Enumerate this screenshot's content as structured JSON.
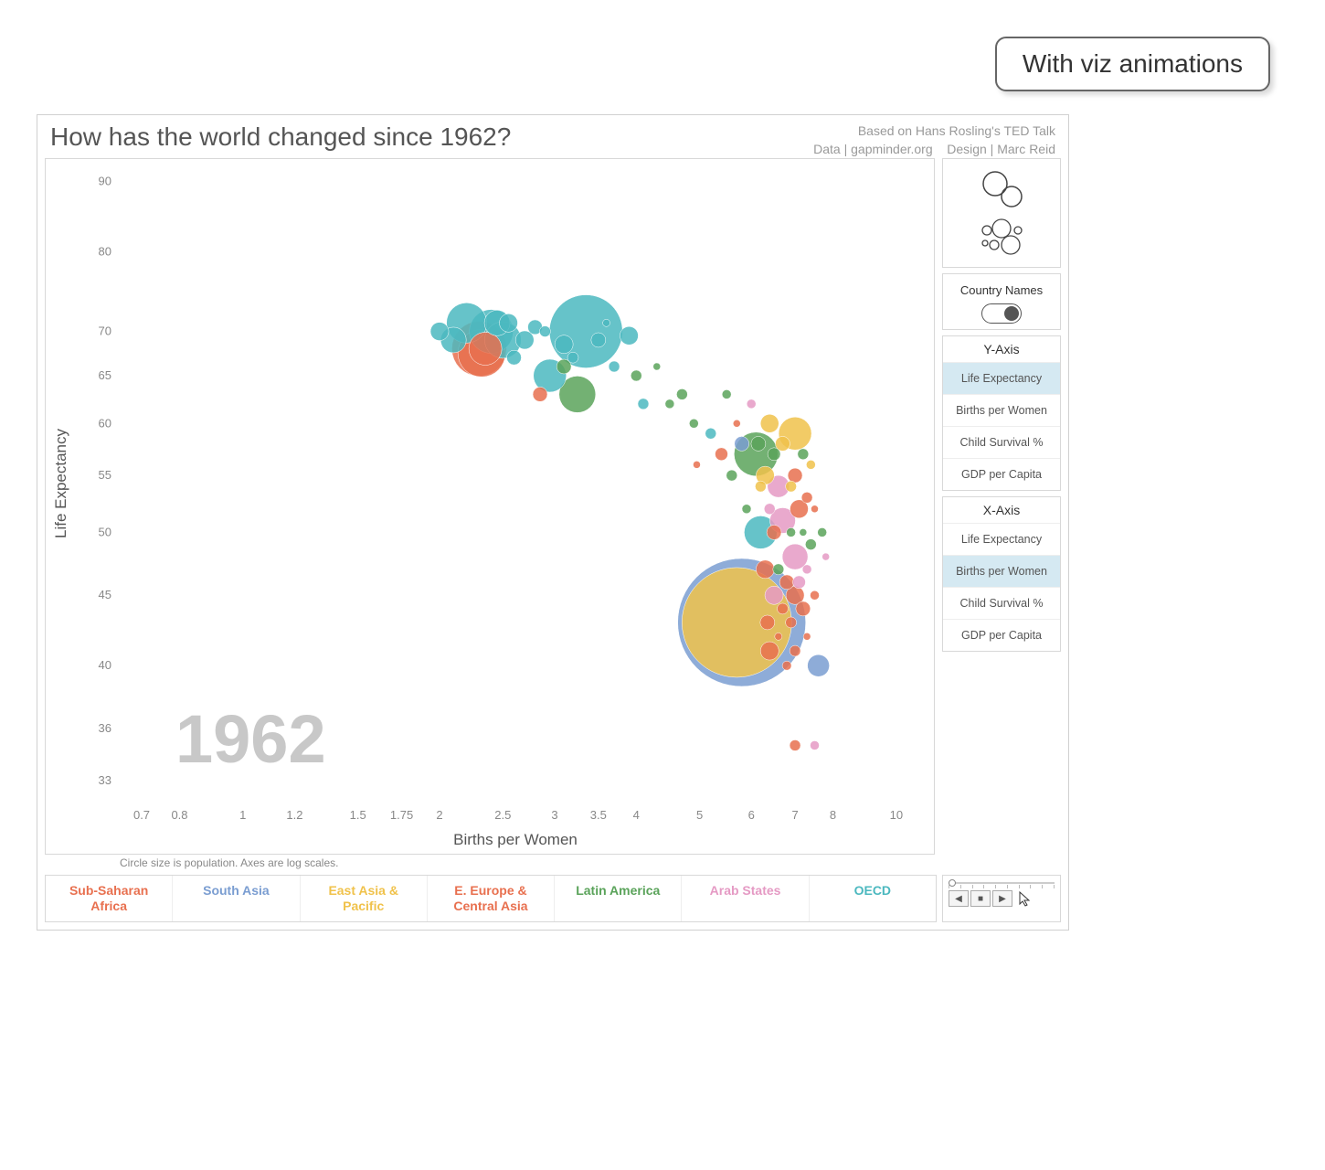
{
  "callout": "With viz animations",
  "header": {
    "title": "How has the world changed since 1962?",
    "credit1": "Based on Hans Rosling's TED Talk",
    "credit2_left": "Data | gapminder.org",
    "credit2_right": "Design | Marc Reid"
  },
  "sidebar": {
    "country_names_label": "Country Names",
    "y_axis_header": "Y-Axis",
    "y_options": [
      "Life Expectancy",
      "Births per Women",
      "Child Survival %",
      "GDP per Capita"
    ],
    "y_selected": 0,
    "x_axis_header": "X-Axis",
    "x_options": [
      "Life Expectancy",
      "Births per Women",
      "Child Survival %",
      "GDP per Capita"
    ],
    "x_selected": 1
  },
  "legend": [
    {
      "label": "Sub-Saharan Africa",
      "color": "#e8704f"
    },
    {
      "label": "South Asia",
      "color": "#7a9dd1"
    },
    {
      "label": "East Asia & Pacific",
      "color": "#f0c24b"
    },
    {
      "label": "E. Europe & Central Asia",
      "color": "#e8704f"
    },
    {
      "label": "Latin America",
      "color": "#5aa35a"
    },
    {
      "label": "Arab States",
      "color": "#e59ac4"
    },
    {
      "label": "OECD",
      "color": "#4bb8bf"
    }
  ],
  "note": "Circle size is population.  Axes are log scales.",
  "chart_data": {
    "type": "scatter",
    "title": "How has the world changed since 1962?",
    "xlabel": "Births per Women",
    "ylabel": "Life Expectancy",
    "year_label": "1962",
    "x_ticks": [
      0.7,
      0.8,
      1,
      1.2,
      1.5,
      1.75,
      2,
      2.5,
      3,
      3.5,
      4,
      5,
      6,
      7,
      8,
      10
    ],
    "y_ticks": [
      33,
      36,
      40,
      45,
      50,
      55,
      60,
      65,
      70,
      80,
      90
    ],
    "xlim": [
      0.65,
      10.5
    ],
    "ylim": [
      32,
      92
    ],
    "size_encodes": "population",
    "log_x": true,
    "log_y": true,
    "series_colors": {
      "Sub-Saharan Africa": "#e8704f",
      "South Asia": "#7a9dd1",
      "East Asia & Pacific": "#f0c24b",
      "E. Europe & Central Asia": "#e8704f",
      "Latin America": "#5aa35a",
      "Arab States": "#e59ac4",
      "OECD": "#4bb8bf"
    },
    "points": [
      {
        "x": 2.0,
        "y": 70,
        "r": 10,
        "region": "OECD"
      },
      {
        "x": 2.1,
        "y": 69,
        "r": 14,
        "region": "OECD"
      },
      {
        "x": 2.2,
        "y": 71,
        "r": 22,
        "region": "OECD"
      },
      {
        "x": 2.3,
        "y": 68,
        "r": 30,
        "region": "E. Europe & Central Asia"
      },
      {
        "x": 2.32,
        "y": 67.5,
        "r": 26,
        "region": "E. Europe & Central Asia"
      },
      {
        "x": 2.35,
        "y": 68,
        "r": 18,
        "region": "E. Europe & Central Asia"
      },
      {
        "x": 2.4,
        "y": 70,
        "r": 24,
        "region": "OECD"
      },
      {
        "x": 2.45,
        "y": 71,
        "r": 14,
        "region": "OECD"
      },
      {
        "x": 2.5,
        "y": 69,
        "r": 20,
        "region": "OECD"
      },
      {
        "x": 2.55,
        "y": 71,
        "r": 10,
        "region": "OECD"
      },
      {
        "x": 2.6,
        "y": 67,
        "r": 8,
        "region": "OECD"
      },
      {
        "x": 2.7,
        "y": 69,
        "r": 10,
        "region": "OECD"
      },
      {
        "x": 2.8,
        "y": 70.5,
        "r": 8,
        "region": "OECD"
      },
      {
        "x": 2.9,
        "y": 70,
        "r": 6,
        "region": "OECD"
      },
      {
        "x": 2.95,
        "y": 65,
        "r": 18,
        "region": "OECD"
      },
      {
        "x": 2.85,
        "y": 63,
        "r": 8,
        "region": "E. Europe & Central Asia"
      },
      {
        "x": 3.1,
        "y": 68.5,
        "r": 10,
        "region": "OECD"
      },
      {
        "x": 3.1,
        "y": 66,
        "r": 8,
        "region": "Latin America"
      },
      {
        "x": 3.2,
        "y": 67,
        "r": 6,
        "region": "OECD"
      },
      {
        "x": 3.25,
        "y": 63,
        "r": 20,
        "region": "Latin America"
      },
      {
        "x": 3.35,
        "y": 70,
        "r": 40,
        "region": "OECD"
      },
      {
        "x": 3.5,
        "y": 69,
        "r": 8,
        "region": "OECD"
      },
      {
        "x": 3.6,
        "y": 71,
        "r": 4,
        "region": "OECD"
      },
      {
        "x": 3.7,
        "y": 66,
        "r": 6,
        "region": "OECD"
      },
      {
        "x": 3.9,
        "y": 69.5,
        "r": 10,
        "region": "OECD"
      },
      {
        "x": 4.0,
        "y": 65,
        "r": 6,
        "region": "Latin America"
      },
      {
        "x": 4.1,
        "y": 62,
        "r": 6,
        "region": "OECD"
      },
      {
        "x": 4.3,
        "y": 66,
        "r": 4,
        "region": "Latin America"
      },
      {
        "x": 4.5,
        "y": 62,
        "r": 5,
        "region": "Latin America"
      },
      {
        "x": 4.7,
        "y": 63,
        "r": 6,
        "region": "Latin America"
      },
      {
        "x": 4.9,
        "y": 60,
        "r": 5,
        "region": "Latin America"
      },
      {
        "x": 4.95,
        "y": 56,
        "r": 4,
        "region": "E. Europe & Central Asia"
      },
      {
        "x": 5.2,
        "y": 59,
        "r": 6,
        "region": "OECD"
      },
      {
        "x": 5.4,
        "y": 57,
        "r": 7,
        "region": "E. Europe & Central Asia"
      },
      {
        "x": 5.5,
        "y": 63,
        "r": 5,
        "region": "Latin America"
      },
      {
        "x": 5.6,
        "y": 55,
        "r": 6,
        "region": "Latin America"
      },
      {
        "x": 5.7,
        "y": 60,
        "r": 4,
        "region": "E. Europe & Central Asia"
      },
      {
        "x": 5.8,
        "y": 58,
        "r": 8,
        "region": "South Asia"
      },
      {
        "x": 5.9,
        "y": 52,
        "r": 5,
        "region": "Latin America"
      },
      {
        "x": 5.8,
        "y": 43,
        "r": 70,
        "region": "South Asia"
      },
      {
        "x": 5.7,
        "y": 43,
        "r": 60,
        "region": "East Asia & Pacific"
      },
      {
        "x": 6.0,
        "y": 62,
        "r": 5,
        "region": "Arab States"
      },
      {
        "x": 6.1,
        "y": 57,
        "r": 24,
        "region": "Latin America"
      },
      {
        "x": 6.15,
        "y": 58,
        "r": 8,
        "region": "Latin America"
      },
      {
        "x": 6.2,
        "y": 54,
        "r": 6,
        "region": "East Asia & Pacific"
      },
      {
        "x": 6.2,
        "y": 50,
        "r": 18,
        "region": "OECD"
      },
      {
        "x": 6.3,
        "y": 55,
        "r": 10,
        "region": "East Asia & Pacific"
      },
      {
        "x": 6.3,
        "y": 47,
        "r": 10,
        "region": "Sub-Saharan Africa"
      },
      {
        "x": 6.35,
        "y": 43,
        "r": 8,
        "region": "Sub-Saharan Africa"
      },
      {
        "x": 6.4,
        "y": 60,
        "r": 10,
        "region": "East Asia & Pacific"
      },
      {
        "x": 6.4,
        "y": 52,
        "r": 6,
        "region": "Arab States"
      },
      {
        "x": 6.4,
        "y": 41,
        "r": 10,
        "region": "Sub-Saharan Africa"
      },
      {
        "x": 6.5,
        "y": 57,
        "r": 7,
        "region": "Latin America"
      },
      {
        "x": 6.5,
        "y": 50,
        "r": 8,
        "region": "Sub-Saharan Africa"
      },
      {
        "x": 6.5,
        "y": 45,
        "r": 10,
        "region": "Arab States"
      },
      {
        "x": 6.6,
        "y": 54,
        "r": 12,
        "region": "Arab States"
      },
      {
        "x": 6.6,
        "y": 47,
        "r": 6,
        "region": "Latin America"
      },
      {
        "x": 6.6,
        "y": 42,
        "r": 4,
        "region": "Sub-Saharan Africa"
      },
      {
        "x": 6.7,
        "y": 58,
        "r": 8,
        "region": "East Asia & Pacific"
      },
      {
        "x": 6.7,
        "y": 51,
        "r": 14,
        "region": "Arab States"
      },
      {
        "x": 6.7,
        "y": 44,
        "r": 6,
        "region": "Sub-Saharan Africa"
      },
      {
        "x": 6.8,
        "y": 46,
        "r": 8,
        "region": "Sub-Saharan Africa"
      },
      {
        "x": 6.8,
        "y": 40,
        "r": 5,
        "region": "Sub-Saharan Africa"
      },
      {
        "x": 6.9,
        "y": 54,
        "r": 6,
        "region": "East Asia & Pacific"
      },
      {
        "x": 6.9,
        "y": 50,
        "r": 5,
        "region": "Latin America"
      },
      {
        "x": 6.9,
        "y": 43,
        "r": 6,
        "region": "Sub-Saharan Africa"
      },
      {
        "x": 7.0,
        "y": 59,
        "r": 18,
        "region": "East Asia & Pacific"
      },
      {
        "x": 7.0,
        "y": 55,
        "r": 8,
        "region": "E. Europe & Central Asia"
      },
      {
        "x": 7.0,
        "y": 48,
        "r": 14,
        "region": "Arab States"
      },
      {
        "x": 7.0,
        "y": 45,
        "r": 10,
        "region": "Sub-Saharan Africa"
      },
      {
        "x": 7.0,
        "y": 41,
        "r": 6,
        "region": "Sub-Saharan Africa"
      },
      {
        "x": 7.1,
        "y": 52,
        "r": 10,
        "region": "Sub-Saharan Africa"
      },
      {
        "x": 7.1,
        "y": 46,
        "r": 7,
        "region": "Arab States"
      },
      {
        "x": 7.2,
        "y": 57,
        "r": 6,
        "region": "Latin America"
      },
      {
        "x": 7.2,
        "y": 50,
        "r": 4,
        "region": "Latin America"
      },
      {
        "x": 7.2,
        "y": 44,
        "r": 8,
        "region": "Sub-Saharan Africa"
      },
      {
        "x": 7.3,
        "y": 53,
        "r": 6,
        "region": "Sub-Saharan Africa"
      },
      {
        "x": 7.3,
        "y": 47,
        "r": 5,
        "region": "Arab States"
      },
      {
        "x": 7.3,
        "y": 42,
        "r": 4,
        "region": "Sub-Saharan Africa"
      },
      {
        "x": 7.4,
        "y": 56,
        "r": 5,
        "region": "East Asia & Pacific"
      },
      {
        "x": 7.4,
        "y": 49,
        "r": 6,
        "region": "Latin America"
      },
      {
        "x": 7.5,
        "y": 52,
        "r": 4,
        "region": "Sub-Saharan Africa"
      },
      {
        "x": 7.5,
        "y": 45,
        "r": 5,
        "region": "Sub-Saharan Africa"
      },
      {
        "x": 7.6,
        "y": 40,
        "r": 12,
        "region": "South Asia"
      },
      {
        "x": 7.7,
        "y": 50,
        "r": 5,
        "region": "Latin America"
      },
      {
        "x": 7.8,
        "y": 48,
        "r": 4,
        "region": "Arab States"
      },
      {
        "x": 7.0,
        "y": 35,
        "r": 6,
        "region": "Sub-Saharan Africa"
      },
      {
        "x": 7.5,
        "y": 35,
        "r": 5,
        "region": "Arab States"
      }
    ]
  }
}
